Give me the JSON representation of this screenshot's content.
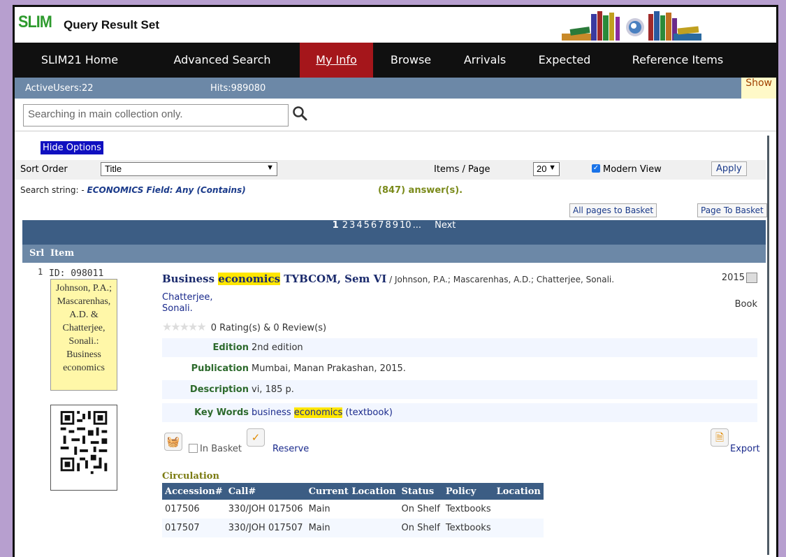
{
  "app": {
    "logo": "SLIM",
    "title": "Query Result Set"
  },
  "nav": {
    "items": [
      "SLIM21 Home",
      "Advanced Search",
      "My Info",
      "Browse",
      "Arrivals",
      "Expected",
      "Reference Items"
    ],
    "active": "My Info"
  },
  "status": {
    "active_users": "ActiveUsers:22",
    "hits": "Hits:989080",
    "show": "Show"
  },
  "search": {
    "placeholder": "Searching in main collection only."
  },
  "options": {
    "hide_label": "Hide Options",
    "sort_label": "Sort Order",
    "sort_value": "Title",
    "items_per_page_label": "Items / Page",
    "items_per_page_value": "20",
    "modern_view_label": "Modern View",
    "modern_view_checked": true,
    "apply_label": "Apply"
  },
  "results": {
    "search_string_prefix": "Search string: - ",
    "search_string": "ECONOMICS Field: Any (Contains)",
    "answers": "(847) answer(s).",
    "all_pages_basket": "All pages to Basket",
    "page_to_basket": "Page To Basket"
  },
  "pager": {
    "current": "1",
    "pages": [
      "2",
      "3",
      "4",
      "5",
      "6",
      "7",
      "8",
      "9",
      "10"
    ],
    "ellipsis": "...",
    "next": "Next"
  },
  "table_header": {
    "srl": "Srl",
    "item": "Item"
  },
  "item": {
    "srl": "1",
    "id": "ID:  098011",
    "card_lines": [
      "Johnson, P.A.;",
      "Mascarenhas,",
      "A.D. &",
      "Chatterjee,",
      "Sonali.:",
      "Business",
      "economics"
    ],
    "title_before": "Business ",
    "title_highlight": "economics",
    "title_after": " TYBCOM, Sem VI",
    "authors": " / Johnson, P.A.; Mascarenhas, A.D.; Chatterjee, Sonali.",
    "year": "2015",
    "type": "Book",
    "author_link_1": "Chatterjee,",
    "author_link_2": "Sonali.",
    "rating": "0 Rating(s) & 0 Review(s)",
    "details": [
      {
        "key": "Edition",
        "value": "2nd edition"
      },
      {
        "key": "Publication",
        "value": "Mumbai, Manan Prakashan, 2015."
      },
      {
        "key": "Description",
        "value": "vi, 185 p."
      }
    ],
    "keywords_label": "Key Words",
    "keywords_before": "business ",
    "keywords_highlight": "economics",
    "keywords_after": " (textbook)",
    "in_basket_label": "In Basket",
    "reserve_label": "Reserve",
    "export_label": "Export"
  },
  "circulation": {
    "title": "Circulation",
    "columns": [
      "Accession#",
      "Call#",
      "Current Location",
      "Status",
      "Policy",
      "Location"
    ],
    "rows": [
      [
        "017506",
        "330/JOH 017506",
        "Main",
        "On Shelf",
        "Textbooks",
        ""
      ],
      [
        "017507",
        "330/JOH 017507",
        "Main",
        "On Shelf",
        "Textbooks",
        ""
      ]
    ]
  },
  "colors": {
    "nav_bg": "#101010",
    "active_tab": "#a5161b",
    "status_bar": "#6c88a7",
    "pager": "#3c5d84",
    "highlight": "#ffe600"
  }
}
